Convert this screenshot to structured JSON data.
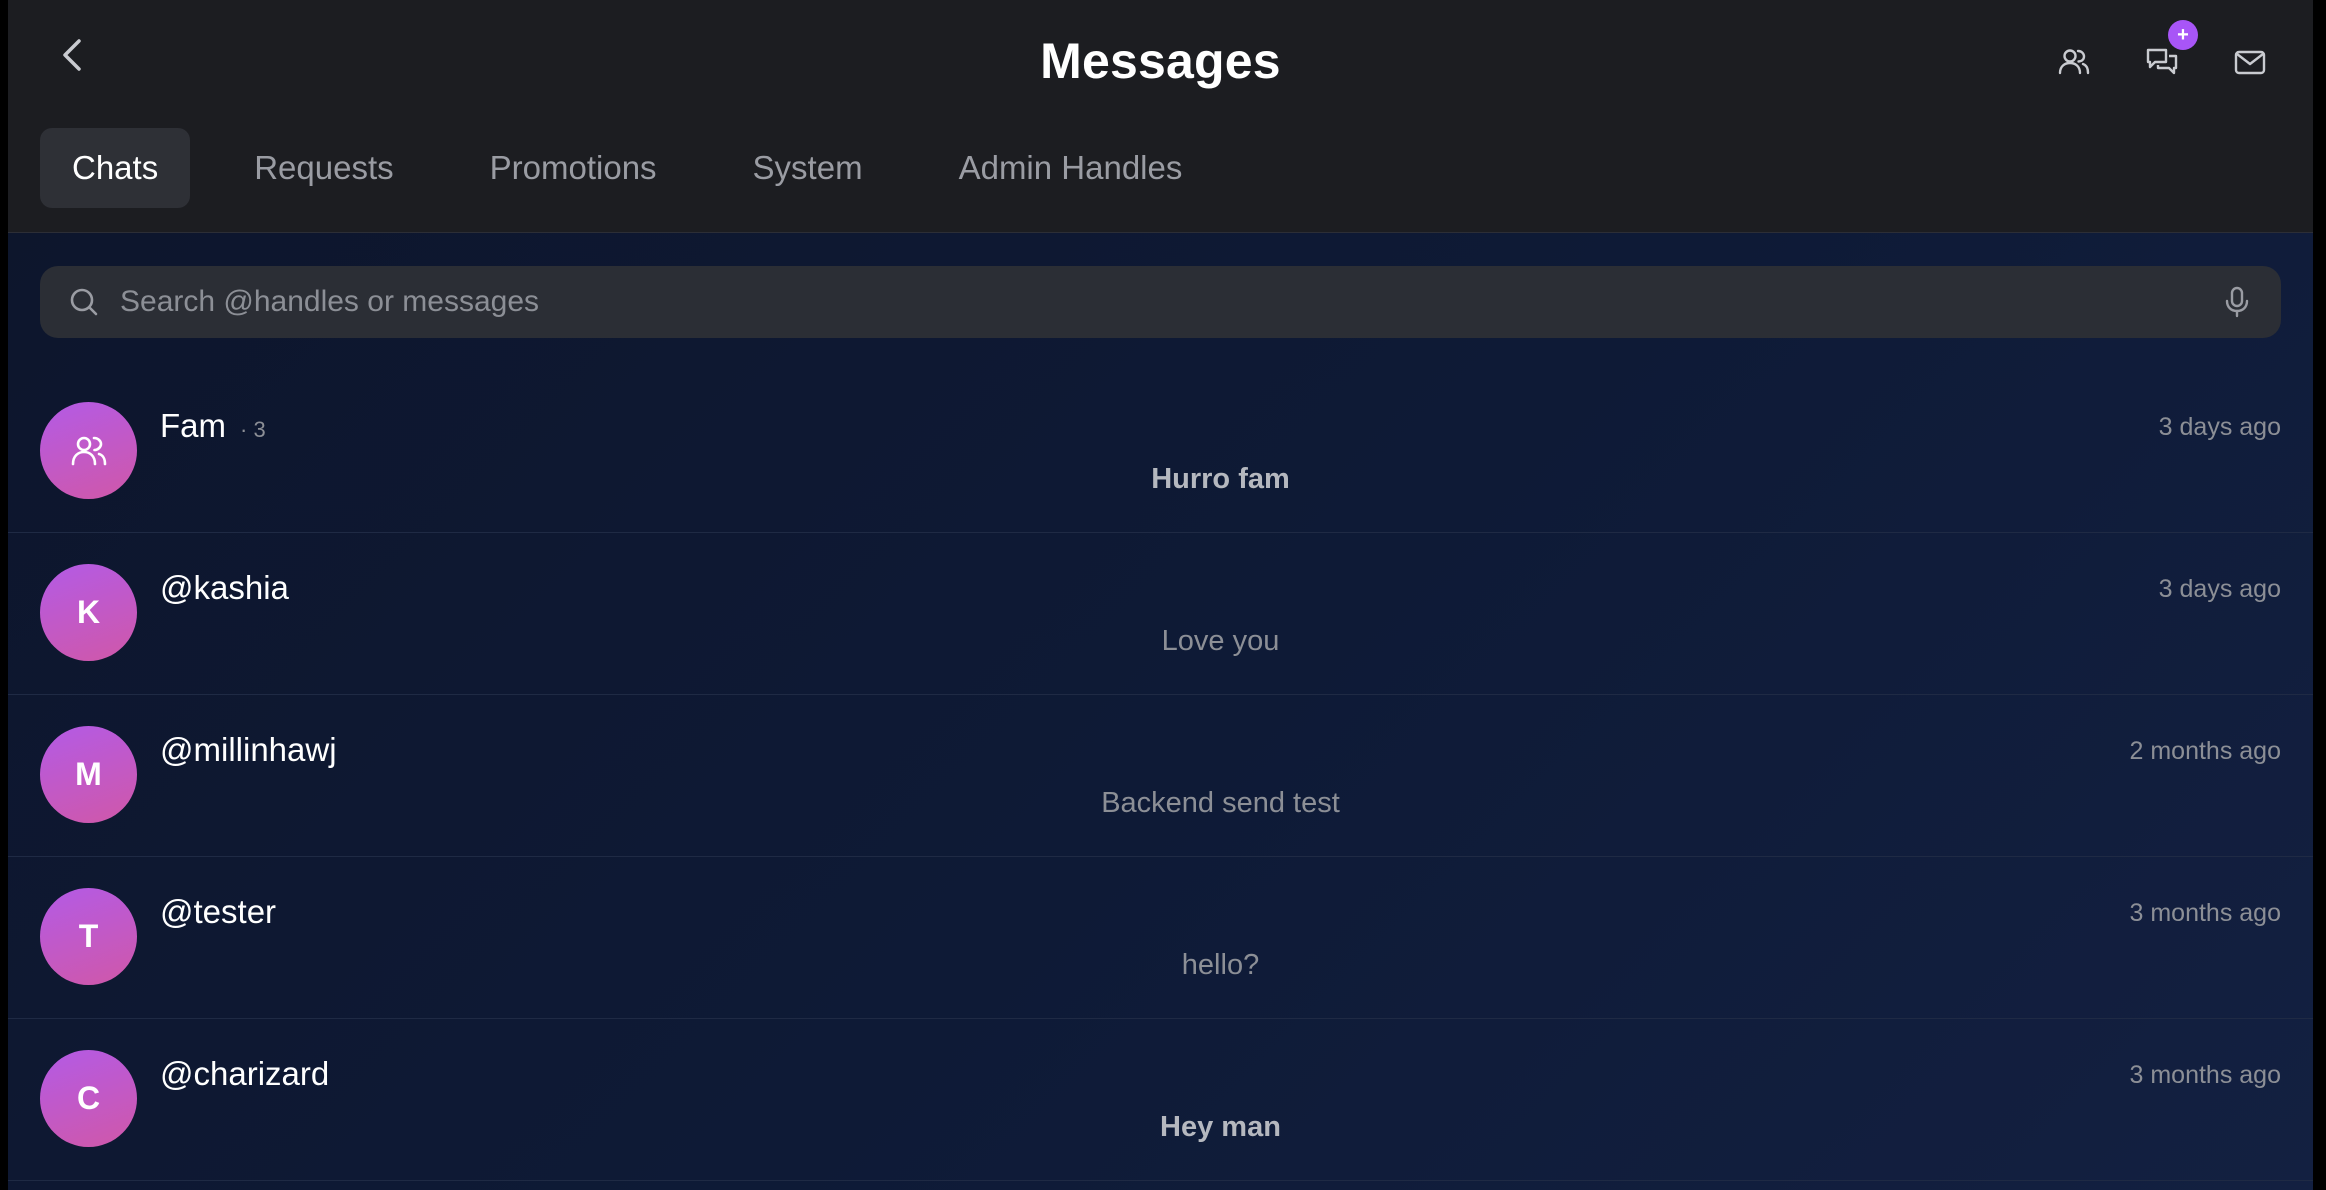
{
  "header": {
    "title": "Messages",
    "back_icon": "chevron-left-icon",
    "actions": [
      {
        "icon": "users-icon"
      },
      {
        "icon": "chat-bubbles-icon",
        "badge": "+"
      },
      {
        "icon": "envelope-icon"
      }
    ]
  },
  "tabs": [
    {
      "label": "Chats",
      "active": true
    },
    {
      "label": "Requests",
      "active": false
    },
    {
      "label": "Promotions",
      "active": false
    },
    {
      "label": "System",
      "active": false
    },
    {
      "label": "Admin Handles",
      "active": false
    }
  ],
  "search": {
    "placeholder": "Search @handles or messages",
    "value": "",
    "icon": "search-icon",
    "mic_icon": "microphone-icon"
  },
  "conversations": [
    {
      "name": "Fam",
      "member_count": "· 3",
      "avatar_icon": "group-icon",
      "avatar_letter": "",
      "time": "3 days ago",
      "preview": "Hurro fam",
      "unread": true
    },
    {
      "name": "@kashia",
      "member_count": "",
      "avatar_letter": "K",
      "time": "3 days ago",
      "preview": "Love you",
      "unread": false
    },
    {
      "name": "@millinhawj",
      "member_count": "",
      "avatar_letter": "M",
      "time": "2 months ago",
      "preview": "Backend send test",
      "unread": false
    },
    {
      "name": "@tester",
      "member_count": "",
      "avatar_letter": "T",
      "time": "3 months ago",
      "preview": "hello?",
      "unread": false
    },
    {
      "name": "@charizard",
      "member_count": "",
      "avatar_letter": "C",
      "time": "3 months ago",
      "preview": "Hey man",
      "unread": true
    }
  ],
  "colors": {
    "accent": "#a855f7",
    "avatar_gradient_start": "#b35ae6",
    "avatar_gradient_end": "#d058a8",
    "header_bg": "#1c1d21",
    "body_bg": "#0e1a36"
  }
}
